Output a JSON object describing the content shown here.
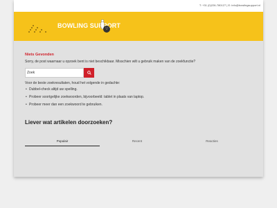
{
  "topbar": {
    "contact": "T: +31 (0)226-780127 | E: info@bowlingsupport.nl"
  },
  "header": {
    "logo_text": "BOWLING SUPPORT",
    "accent": "#f6c21a"
  },
  "not_found": {
    "title": "Niets Gevonden",
    "description": "Sorry, de post waarnaar u opzoek bent is niet beschikbaar. Misschien wilt u gebruik maken van de zoekfunctie?"
  },
  "search": {
    "value": "Zoek",
    "button_icon": "search-icon",
    "button_color": "#d0202a"
  },
  "tips": {
    "intro": "Voor de beste zoekresultaten, houd het volgende in gedachte:",
    "items": [
      "Dubbel-check altijd uw spelling.",
      "Probeer soortgelijke zoekwoorden, bijvoorbeeld: tablet in plaats van laptop.",
      "Probeer meer dan een zoekwoord te gebruiken."
    ]
  },
  "alternatives": {
    "title": "Liever wat artikelen doorzoeken?",
    "tabs": [
      {
        "label": "Populair"
      },
      {
        "label": "Recent"
      },
      {
        "label": "Reacties"
      }
    ]
  }
}
